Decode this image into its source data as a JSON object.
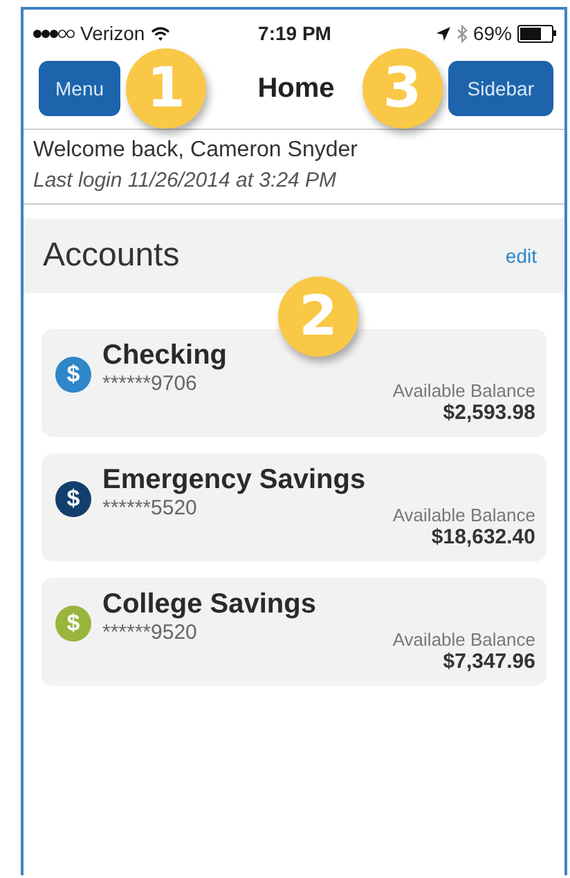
{
  "status_bar": {
    "carrier": "Verizon",
    "time": "7:19 PM",
    "battery_text": "69%"
  },
  "nav": {
    "title": "Home",
    "left_button": "Menu",
    "right_button": "Sidebar"
  },
  "welcome": {
    "greeting": "Welcome back, Cameron Snyder",
    "last_login": "Last login 11/26/2014 at 3:24 PM"
  },
  "accounts_header": {
    "title": "Accounts",
    "action": "edit"
  },
  "accounts": [
    {
      "name": "Checking",
      "number": "******9706",
      "balance_label": "Available Balance",
      "balance": "$2,593.98",
      "icon_glyph": "$",
      "color": "#2f86c8"
    },
    {
      "name": "Emergency Savings",
      "number": "******5520",
      "balance_label": "Available Balance",
      "balance": "$18,632.40",
      "icon_glyph": "$",
      "color": "#123f6e"
    },
    {
      "name": "College Savings",
      "number": "******9520",
      "balance_label": "Available Balance",
      "balance": "$7,347.96",
      "icon_glyph": "$",
      "color": "#9ab53c"
    }
  ],
  "callouts": [
    "1",
    "2",
    "3"
  ]
}
